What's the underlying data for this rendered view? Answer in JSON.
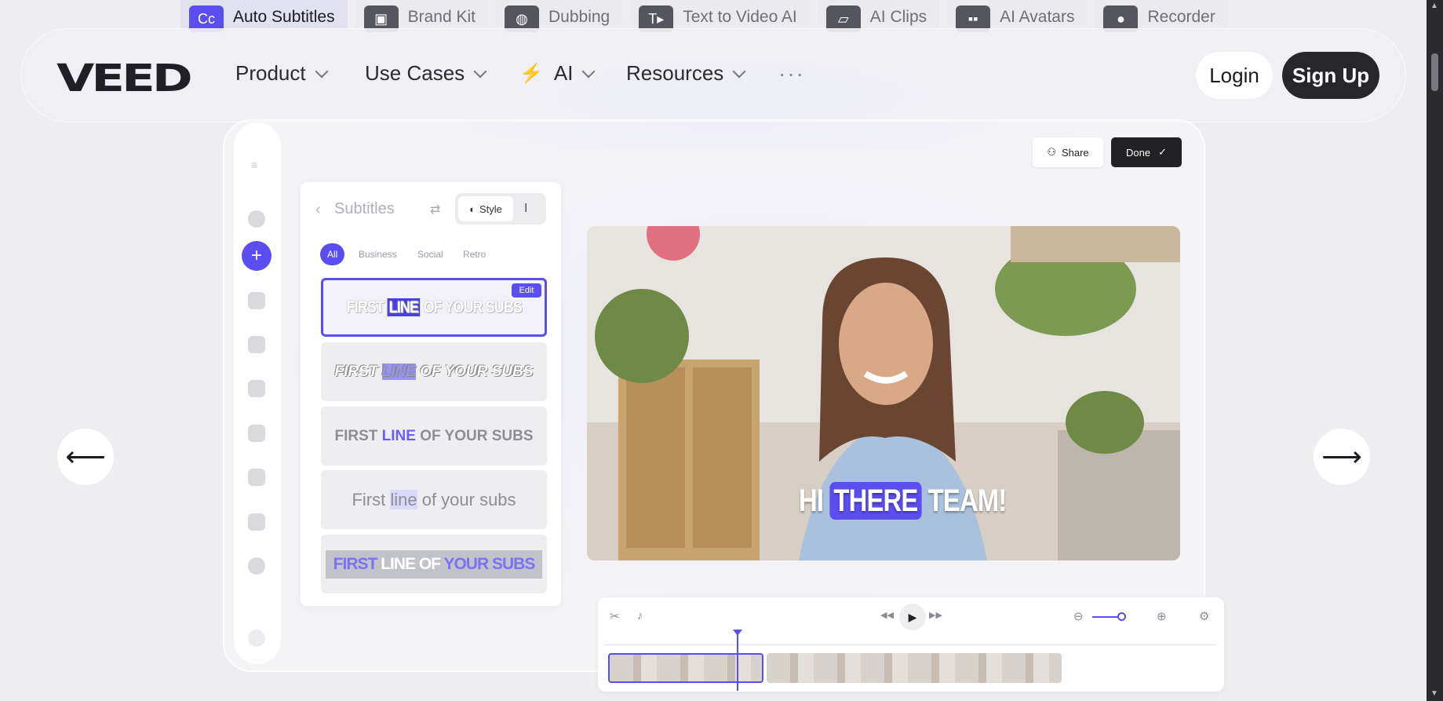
{
  "feature_tabs": [
    {
      "label": "Auto Subtitles",
      "icon": "captions-icon",
      "glyph": "Cc",
      "active": true
    },
    {
      "label": "Brand Kit",
      "icon": "brand-kit-icon",
      "glyph": "▣",
      "active": false
    },
    {
      "label": "Dubbing",
      "icon": "globe-icon",
      "glyph": "◍",
      "active": false
    },
    {
      "label": "Text to Video AI",
      "icon": "text-to-video-icon",
      "glyph": "T▸",
      "active": false
    },
    {
      "label": "AI Clips",
      "icon": "clips-icon",
      "glyph": "▱",
      "active": false
    },
    {
      "label": "AI Avatars",
      "icon": "avatar-icon",
      "glyph": "▪▪",
      "active": false
    },
    {
      "label": "Recorder",
      "icon": "recorder-icon",
      "glyph": "●",
      "active": false
    }
  ],
  "nav": {
    "logo": "VEED",
    "items": [
      "Product",
      "Use Cases",
      "AI",
      "Resources"
    ],
    "more": "···",
    "login": "Login",
    "signup": "Sign Up"
  },
  "editor": {
    "share": "Share",
    "done": "Done",
    "panel_title": "Subtitles",
    "style_tab": "Style",
    "filters": [
      "All",
      "Business",
      "Social",
      "Retro"
    ],
    "edit_badge": "Edit",
    "styles": [
      {
        "a": "FIRST ",
        "hl": "LINE",
        "b": " OF YOUR SUBS"
      },
      {
        "a": "FIRST ",
        "hl": "LINE",
        "b": " OF YOUR SUBS"
      },
      {
        "a": "FIRST ",
        "hl": "LINE",
        "b": " OF YOUR SUBS"
      },
      {
        "a": "First ",
        "hl": "line",
        "b": " of your subs"
      },
      {
        "a": "FIRST ",
        "hl": "LINE OF",
        "b": " YOUR SUBS"
      }
    ],
    "caption": {
      "a": "HI ",
      "hl": "THERE",
      "b": " TEAM!"
    }
  },
  "colors": {
    "accent": "#5b4ef0",
    "dark_button": "#27272b"
  }
}
